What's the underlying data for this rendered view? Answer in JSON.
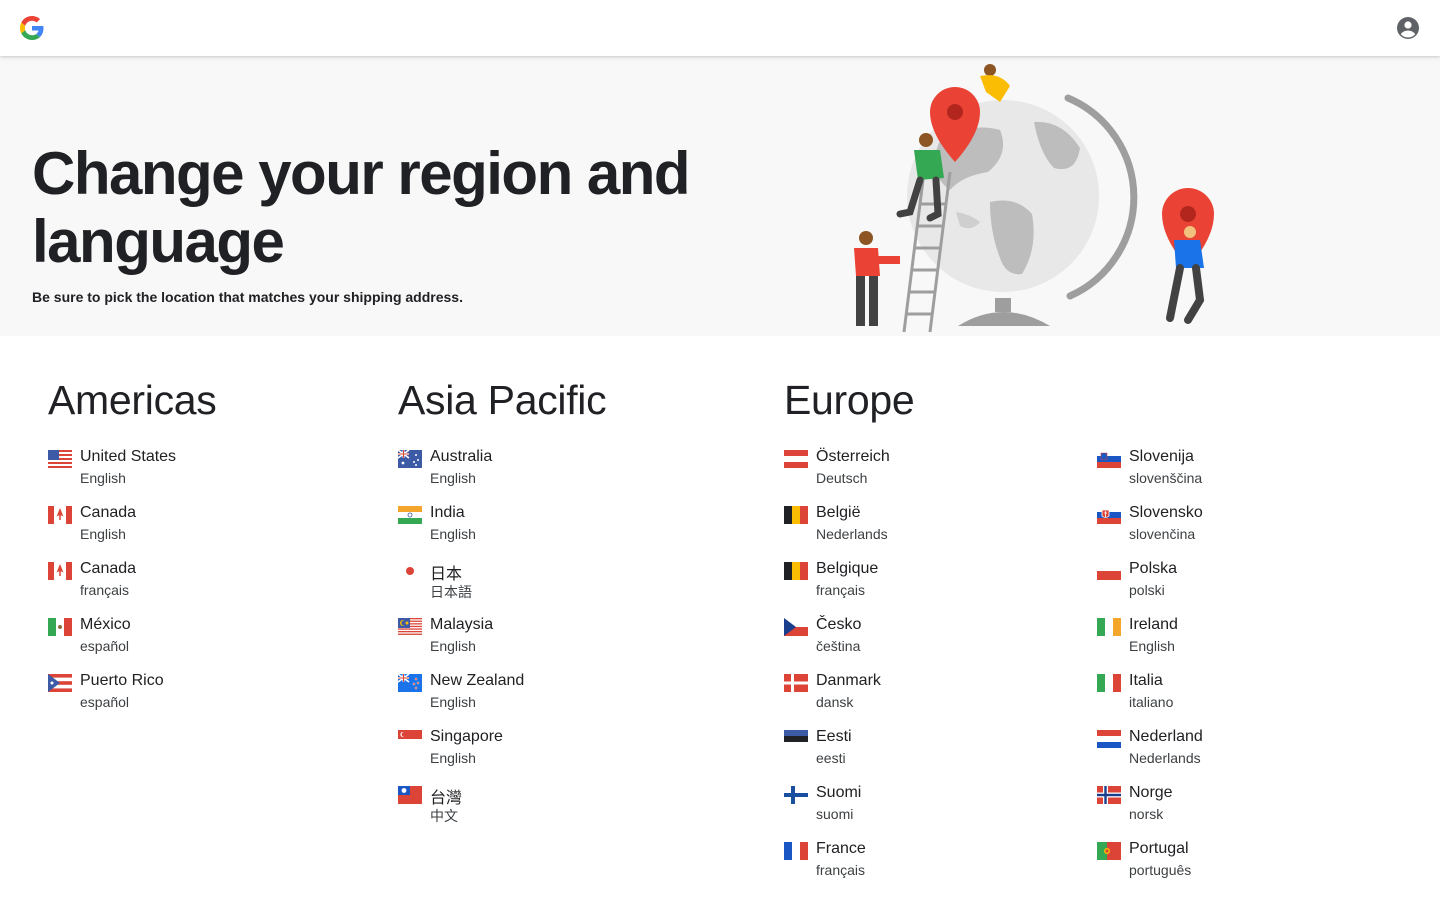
{
  "header": {
    "logo_icon": "google-g-logo-icon",
    "account_icon": "account-circle-icon"
  },
  "hero": {
    "title": "Change your region and language",
    "subtitle": "Be sure to pick the location that matches your shipping address.",
    "illustration": "globe-illustration-with-people-and-map-pins"
  },
  "regions": {
    "americas": {
      "title": "Americas",
      "countries": [
        {
          "name": "United States",
          "language": "English",
          "flag": "us-flag-icon"
        },
        {
          "name": "Canada",
          "language": "English",
          "flag": "canada-flag-icon"
        },
        {
          "name": "Canada",
          "language": "français",
          "flag": "canada-flag-icon"
        },
        {
          "name": "México",
          "language": "español",
          "flag": "mexico-flag-icon"
        },
        {
          "name": "Puerto Rico",
          "language": "español",
          "flag": "puerto-rico-flag-icon"
        }
      ]
    },
    "asia_pacific": {
      "title": "Asia Pacific",
      "countries": [
        {
          "name": "Australia",
          "language": "English",
          "flag": "australia-flag-icon"
        },
        {
          "name": "India",
          "language": "English",
          "flag": "india-flag-icon"
        },
        {
          "name": "日本",
          "language": "日本語",
          "flag": "japan-flag-icon"
        },
        {
          "name": "Malaysia",
          "language": "English",
          "flag": "malaysia-flag-icon"
        },
        {
          "name": "New Zealand",
          "language": "English",
          "flag": "new-zealand-flag-icon"
        },
        {
          "name": "Singapore",
          "language": "English",
          "flag": "singapore-flag-icon"
        },
        {
          "name": "台灣",
          "language": "中文",
          "flag": "taiwan-flag-icon"
        }
      ]
    },
    "europe": {
      "title": "Europe",
      "countries_col1": [
        {
          "name": "Österreich",
          "language": "Deutsch",
          "flag": "austria-flag-icon"
        },
        {
          "name": "België",
          "language": "Nederlands",
          "flag": "belgium-flag-icon"
        },
        {
          "name": "Belgique",
          "language": "français",
          "flag": "belgium-flag-icon"
        },
        {
          "name": "Česko",
          "language": "čeština",
          "flag": "czech-flag-icon"
        },
        {
          "name": "Danmark",
          "language": "dansk",
          "flag": "denmark-flag-icon"
        },
        {
          "name": "Eesti",
          "language": "eesti",
          "flag": "estonia-flag-icon"
        },
        {
          "name": "Suomi",
          "language": "suomi",
          "flag": "finland-flag-icon"
        },
        {
          "name": "France",
          "language": "français",
          "flag": "france-flag-icon"
        }
      ],
      "countries_col2": [
        {
          "name": "Slovenija",
          "language": "slovenščina",
          "flag": "slovenia-flag-icon"
        },
        {
          "name": "Slovensko",
          "language": "slovenčina",
          "flag": "slovakia-flag-icon"
        },
        {
          "name": "Polska",
          "language": "polski",
          "flag": "poland-flag-icon"
        },
        {
          "name": "Ireland",
          "language": "English",
          "flag": "ireland-flag-icon"
        },
        {
          "name": "Italia",
          "language": "italiano",
          "flag": "italy-flag-icon"
        },
        {
          "name": "Nederland",
          "language": "Nederlands",
          "flag": "netherlands-flag-icon"
        },
        {
          "name": "Norge",
          "language": "norsk",
          "flag": "norway-flag-icon"
        },
        {
          "name": "Portugal",
          "language": "português",
          "flag": "portugal-flag-icon"
        }
      ]
    }
  },
  "colors": {
    "text_primary": "#202124",
    "text_secondary": "#3c4043",
    "hero_background": "#f8f8f8",
    "google_blue": "#4285f4",
    "google_red": "#ea4335",
    "google_yellow": "#fbbc04",
    "google_green": "#34a853"
  }
}
